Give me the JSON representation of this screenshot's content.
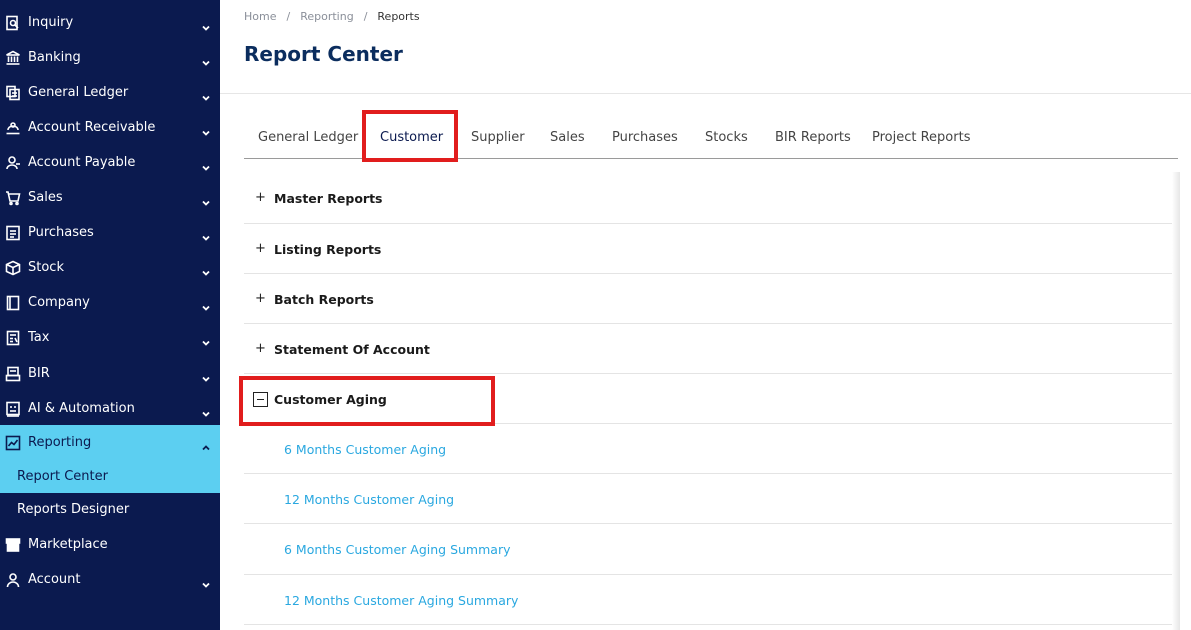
{
  "sidebar": {
    "items": [
      {
        "label": "Inquiry",
        "icon": "inquiry-icon"
      },
      {
        "label": "Banking",
        "icon": "bank-icon"
      },
      {
        "label": "General Ledger",
        "icon": "ledger-icon"
      },
      {
        "label": "Account Receivable",
        "icon": "receivable-icon"
      },
      {
        "label": "Account Payable",
        "icon": "payable-icon"
      },
      {
        "label": "Sales",
        "icon": "cart-icon"
      },
      {
        "label": "Purchases",
        "icon": "purchases-icon"
      },
      {
        "label": "Stock",
        "icon": "box-icon"
      },
      {
        "label": "Company",
        "icon": "company-icon"
      },
      {
        "label": "Tax",
        "icon": "tax-icon"
      },
      {
        "label": "BIR",
        "icon": "bir-icon"
      },
      {
        "label": "AI & Automation",
        "icon": "automation-icon"
      },
      {
        "label": "Reporting",
        "icon": "chart-icon"
      }
    ],
    "sub_items": [
      {
        "label": "Report Center"
      },
      {
        "label": "Reports Designer"
      }
    ],
    "bottom_items": [
      {
        "label": "Marketplace",
        "icon": "store-icon"
      },
      {
        "label": "Account",
        "icon": "user-icon"
      }
    ]
  },
  "breadcrumb": {
    "home": "Home",
    "reporting": "Reporting",
    "current": "Reports",
    "separator": "/"
  },
  "page": {
    "title": "Report Center"
  },
  "tabs": [
    {
      "label": "General Ledger"
    },
    {
      "label": "Customer"
    },
    {
      "label": "Supplier"
    },
    {
      "label": "Sales"
    },
    {
      "label": "Purchases"
    },
    {
      "label": "Stocks"
    },
    {
      "label": "BIR Reports"
    },
    {
      "label": "Project Reports"
    }
  ],
  "sections": [
    {
      "label": "Master Reports",
      "toggle": "+"
    },
    {
      "label": "Listing Reports",
      "toggle": "+"
    },
    {
      "label": "Batch Reports",
      "toggle": "+"
    },
    {
      "label": "Statement Of Account",
      "toggle": "+"
    },
    {
      "label": "Customer Aging"
    }
  ],
  "aging_reports": [
    {
      "label": "6 Months Customer Aging"
    },
    {
      "label": "12 Months Customer Aging"
    },
    {
      "label": "6 Months Customer Aging Summary"
    },
    {
      "label": "12 Months Customer Aging Summary"
    }
  ],
  "colors": {
    "sidebar_bg": "#0b1a4f",
    "active_bg": "#5ccff1",
    "title": "#0b2d5e",
    "link": "#2aa8e0",
    "highlight": "#e11d1d"
  }
}
